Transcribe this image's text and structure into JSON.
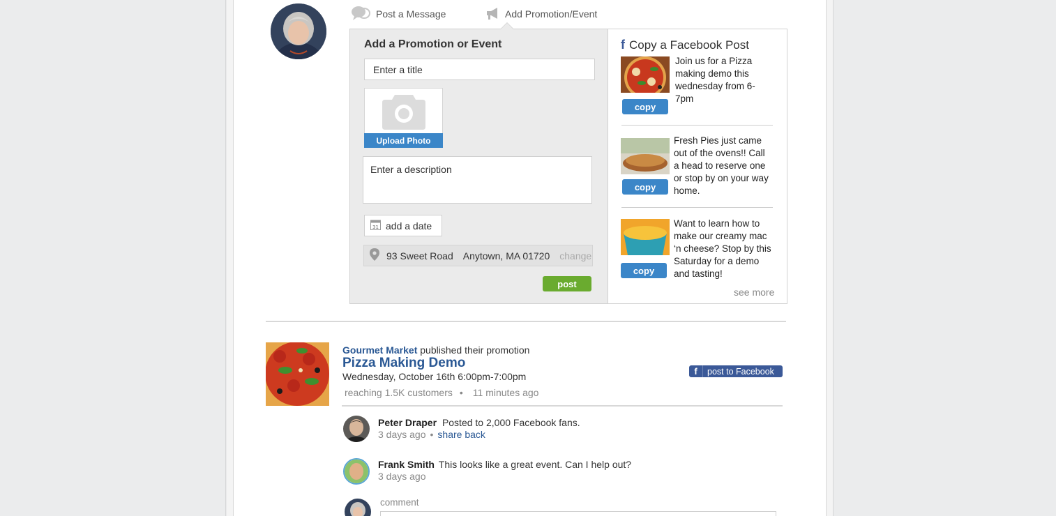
{
  "tabs": {
    "post_message": "Post a Message",
    "add_promotion": "Add Promotion/Event"
  },
  "composer": {
    "heading": "Add a Promotion or Event",
    "title_placeholder": "Enter a title",
    "upload_photo": "Upload Photo",
    "description_placeholder": "Enter a description",
    "date_label": "add a date",
    "address": "93 Sweet Road",
    "city": "Anytown, MA 01720",
    "change": "change",
    "post": "post"
  },
  "facebook_panel": {
    "heading": "Copy a Facebook Post",
    "copy_label": "copy",
    "posts": [
      {
        "text": "Join us for a Pizza making demo this wednesday from 6-7pm"
      },
      {
        "text": "Fresh Pies just came out of the ovens!! Call a head to reserve one or stop by on your way home."
      },
      {
        "text": "Want to learn how to make our creamy mac ‘n cheese? Stop by this Saturday for a demo and tasting!"
      }
    ],
    "see_more": "see more"
  },
  "feed": {
    "publisher": "Gourmet Market",
    "published_text": "published their promotion",
    "promo_title": "Pizza Making Demo",
    "promo_date": "Wednesday, October 16th 6:00pm-7:00pm",
    "reach": "reaching 1.5K customers",
    "bullet": "•",
    "time": "11 minutes ago",
    "post_to_facebook": "post to Facebook",
    "comments": [
      {
        "name": "Peter Draper",
        "text": "Posted to 2,000 Facebook fans.",
        "time": "3 days ago",
        "action": "share back"
      },
      {
        "name": "Frank Smith",
        "text": "This looks like a great event. Can I help out?",
        "time": "3 days ago"
      }
    ],
    "comment_label": "comment"
  },
  "colors": {
    "accent_blue": "#3b86c8",
    "link_blue": "#2a5894",
    "facebook_blue": "#3b5998",
    "post_green": "#6aab2f"
  }
}
